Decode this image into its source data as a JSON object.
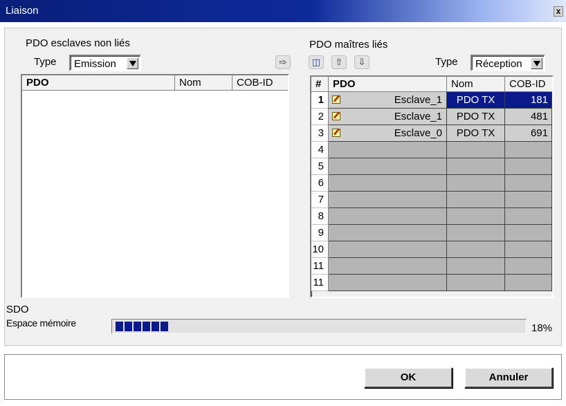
{
  "window": {
    "title": "Liaison",
    "close_label": "x"
  },
  "left_panel": {
    "title": "PDO esclaves non liés",
    "type_label": "Type",
    "type_value": "Emission",
    "columns": [
      "PDO",
      "Nom",
      "COB-ID"
    ]
  },
  "right_panel": {
    "title": "PDO maîtres liés",
    "type_label": "Type",
    "type_value": "Réception",
    "columns": [
      "#",
      "PDO",
      "Nom",
      "COB-ID"
    ],
    "rows": [
      {
        "num": "1",
        "pdo": "Esclave_1",
        "nom": "PDO TX",
        "cob": "181"
      },
      {
        "num": "2",
        "pdo": "Esclave_1",
        "nom": "PDO TX",
        "cob": "481"
      },
      {
        "num": "3",
        "pdo": "Esclave_0",
        "nom": "PDO TX",
        "cob": "691"
      },
      {
        "num": "4",
        "pdo": "",
        "nom": "",
        "cob": ""
      },
      {
        "num": "5",
        "pdo": "",
        "nom": "",
        "cob": ""
      },
      {
        "num": "6",
        "pdo": "",
        "nom": "",
        "cob": ""
      },
      {
        "num": "7",
        "pdo": "",
        "nom": "",
        "cob": ""
      },
      {
        "num": "8",
        "pdo": "",
        "nom": "",
        "cob": ""
      },
      {
        "num": "9",
        "pdo": "",
        "nom": "",
        "cob": ""
      },
      {
        "num": "10",
        "pdo": "",
        "nom": "",
        "cob": ""
      },
      {
        "num": "11",
        "pdo": "",
        "nom": "",
        "cob": ""
      },
      {
        "num": "11",
        "pdo": "",
        "nom": "",
        "cob": ""
      }
    ]
  },
  "toolbar": {
    "move_right_icon": "arrow-right-icon",
    "delete_icon": "trash-icon",
    "move_up_icon": "arrow-up-icon",
    "move_down_icon": "arrow-down-icon"
  },
  "sdo": {
    "label": "SDO",
    "memory_label": "Espace mémoire",
    "progress_percent": 18,
    "progress_text": "18%"
  },
  "buttons": {
    "ok": "OK",
    "cancel": "Annuler"
  },
  "colors": {
    "selection": "#0a1a8a",
    "title_bar": "#0d2a9a",
    "progress": "#0a1a8a"
  }
}
